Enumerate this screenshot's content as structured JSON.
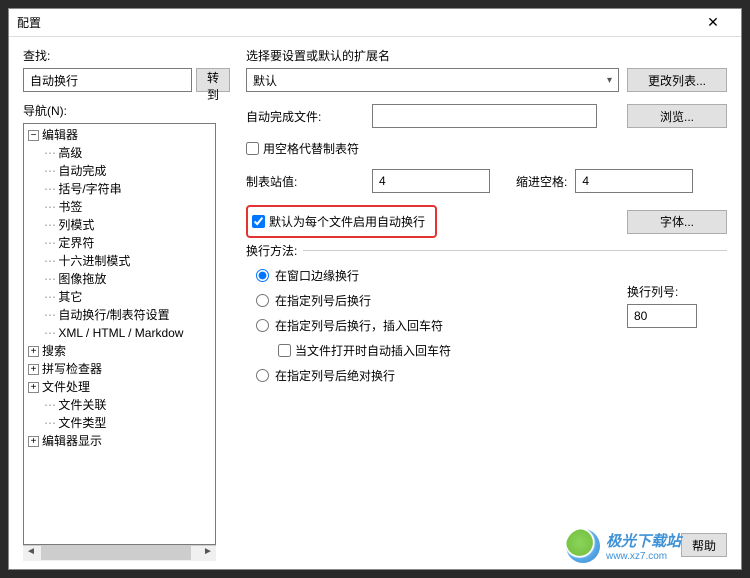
{
  "titlebar": {
    "title": "配置",
    "close": "✕"
  },
  "left": {
    "search_label": "查找:",
    "search_value": "自动换行",
    "goto_btn": "转到",
    "nav_label": "导航(N):",
    "tree": [
      {
        "lvl": 0,
        "tgl": "−",
        "label": "编辑器"
      },
      {
        "lvl": 1,
        "tgl": "",
        "label": "高级"
      },
      {
        "lvl": 1,
        "tgl": "",
        "label": "自动完成"
      },
      {
        "lvl": 1,
        "tgl": "",
        "label": "括号/字符串"
      },
      {
        "lvl": 1,
        "tgl": "",
        "label": "书签"
      },
      {
        "lvl": 1,
        "tgl": "",
        "label": "列模式"
      },
      {
        "lvl": 1,
        "tgl": "",
        "label": "定界符"
      },
      {
        "lvl": 1,
        "tgl": "",
        "label": "十六进制模式"
      },
      {
        "lvl": 1,
        "tgl": "",
        "label": "图像拖放"
      },
      {
        "lvl": 1,
        "tgl": "",
        "label": "其它"
      },
      {
        "lvl": 1,
        "tgl": "",
        "label": "自动换行/制表符设置"
      },
      {
        "lvl": 1,
        "tgl": "",
        "label": "XML / HTML / Markdow"
      },
      {
        "lvl": 0,
        "tgl": "+",
        "label": "搜索"
      },
      {
        "lvl": 0,
        "tgl": "+",
        "label": "拼写检查器"
      },
      {
        "lvl": 0,
        "tgl": "+",
        "label": "文件处理"
      },
      {
        "lvl": 1,
        "tgl": "",
        "label": "文件关联"
      },
      {
        "lvl": 1,
        "tgl": "",
        "label": "文件类型"
      },
      {
        "lvl": 0,
        "tgl": "+",
        "label": "编辑器显示"
      }
    ]
  },
  "right": {
    "ext_label": "选择要设置或默认的扩展名",
    "ext_select": "默认",
    "change_list_btn": "更改列表...",
    "autocomp_label": "自动完成文件:",
    "autocomp_value": "",
    "browse_btn": "浏览...",
    "use_spaces_label": "用空格代替制表符",
    "tab_stop_label": "制表站值:",
    "tab_stop_value": "4",
    "indent_label": "缩进空格:",
    "indent_value": "4",
    "enable_wrap_label": "默认为每个文件启用自动换行",
    "font_btn": "字体...",
    "wrap_group": "换行方法:",
    "r1": "在窗口边缘换行",
    "r2": "在指定列号后换行",
    "r3": "在指定列号后换行，插入回车符",
    "r3_sub": "当文件打开时自动插入回车符",
    "r4": "在指定列号后绝对换行",
    "wrap_col_label": "换行列号:",
    "wrap_col_value": "80",
    "help_btn": "帮助"
  },
  "watermark": {
    "l1": "极光下载站",
    "l2": "www.xz7.com"
  }
}
